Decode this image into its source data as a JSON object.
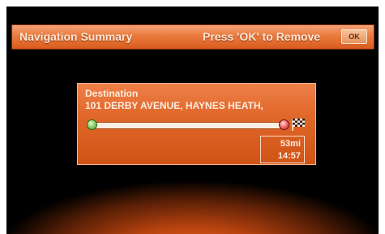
{
  "header": {
    "title": "Navigation Summary",
    "hint": "Press 'OK' to Remove",
    "ok_label": "OK"
  },
  "destination": {
    "label": "Destination",
    "address": "101 DERBY AVENUE, HAYNES HEATH,",
    "distance": "53mi",
    "eta": "14:57"
  },
  "icons": {
    "start": "start-marker-icon",
    "end": "end-marker-icon",
    "finish": "checkered-flag-icon"
  },
  "colors": {
    "accent": "#e0672a",
    "header_top": "#f4a57a",
    "text": "#fdece0"
  }
}
